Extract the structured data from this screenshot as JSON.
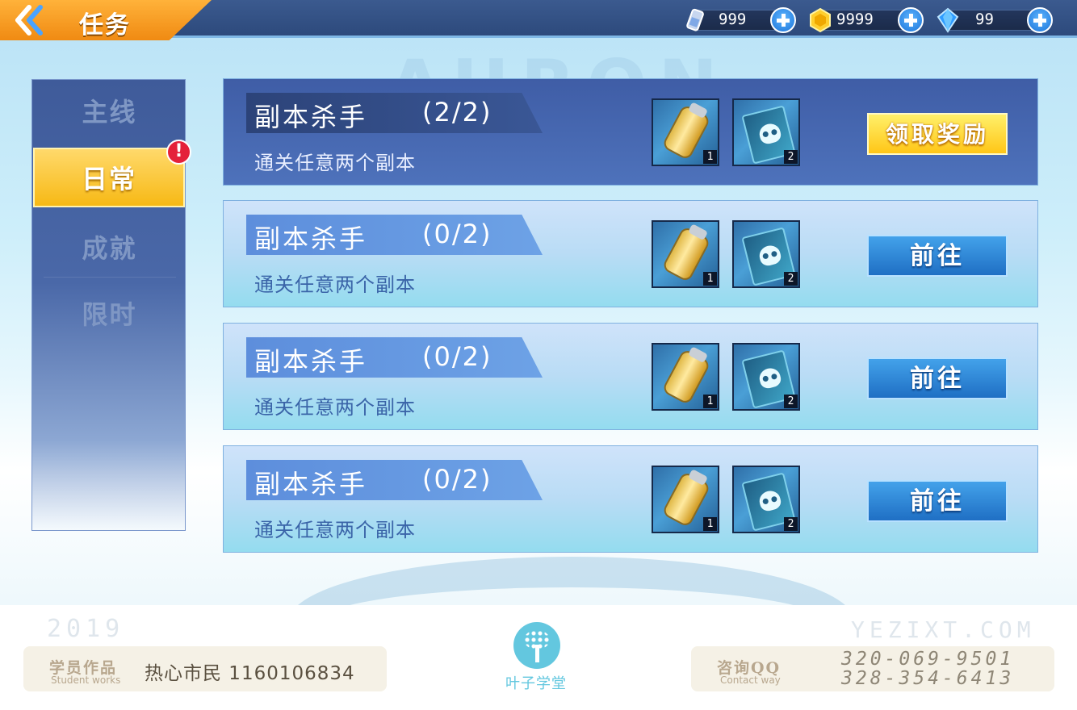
{
  "header": {
    "title": "任务",
    "resources": [
      {
        "icon": "potion-icon",
        "value": "999"
      },
      {
        "icon": "coin-icon",
        "value": "9999"
      },
      {
        "icon": "gem-icon",
        "value": "99"
      }
    ]
  },
  "sidebar": {
    "tabs": [
      {
        "label": "主线",
        "active": false
      },
      {
        "label": "日常",
        "active": true
      },
      {
        "label": "成就",
        "active": false
      },
      {
        "label": "限时",
        "active": false
      }
    ],
    "alert_badge": "!"
  },
  "tasks": [
    {
      "name": "副本杀手",
      "progress": "(2/2)",
      "desc": "通关任意两个副本",
      "state": "done",
      "rewards": [
        {
          "icon": "energy-can-icon",
          "qty": "1"
        },
        {
          "icon": "skull-card-icon",
          "qty": "2"
        }
      ],
      "button": "领取奖励"
    },
    {
      "name": "副本杀手",
      "progress": "(0/2)",
      "desc": "通关任意两个副本",
      "state": "todo",
      "rewards": [
        {
          "icon": "energy-can-icon",
          "qty": "1"
        },
        {
          "icon": "skull-card-icon",
          "qty": "2"
        }
      ],
      "button": "前往"
    },
    {
      "name": "副本杀手",
      "progress": "(0/2)",
      "desc": "通关任意两个副本",
      "state": "todo",
      "rewards": [
        {
          "icon": "energy-can-icon",
          "qty": "1"
        },
        {
          "icon": "skull-card-icon",
          "qty": "2"
        }
      ],
      "button": "前往"
    },
    {
      "name": "副本杀手",
      "progress": "(0/2)",
      "desc": "通关任意两个副本",
      "state": "todo",
      "rewards": [
        {
          "icon": "energy-can-icon",
          "qty": "1"
        },
        {
          "icon": "skull-card-icon",
          "qty": "2"
        }
      ],
      "button": "前往"
    }
  ],
  "footer": {
    "year": "2019",
    "site": "YEZIXT.COM",
    "student_label": "学员作品",
    "student_sub": "Student works",
    "author": "热心市民 1160106834",
    "logo_text": "叶子学堂",
    "contact_label": "咨询QQ",
    "contact_sub": "Contact way",
    "phones": [
      "320-069-9501",
      "328-354-6413"
    ]
  },
  "colors": {
    "topbar": "#2d4a7c",
    "accent_orange": "#f08a12",
    "active_tab": "#f7b915",
    "go_button": "#1f6fc4",
    "claim_button": "#ffc617",
    "alert": "#e4213a"
  }
}
